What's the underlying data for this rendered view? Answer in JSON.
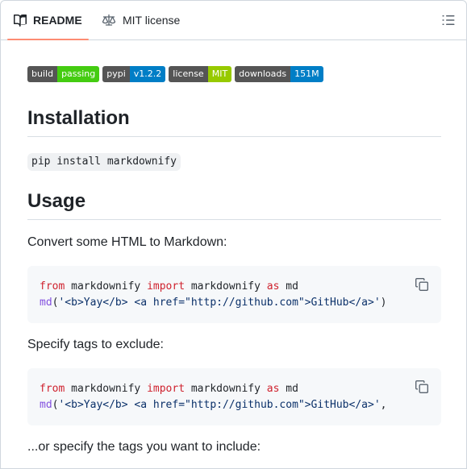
{
  "tabs": {
    "readme_label": "README",
    "license_label": "MIT license"
  },
  "badges": [
    {
      "label": "build",
      "value": "passing",
      "color": "#4c1"
    },
    {
      "label": "pypi",
      "value": "v1.2.2",
      "color": "#007ec6"
    },
    {
      "label": "license",
      "value": "MIT",
      "color": "#97ca00"
    },
    {
      "label": "downloads",
      "value": "151M",
      "color": "#007ec6"
    }
  ],
  "installation": {
    "heading": "Installation",
    "command": "pip install markdownify"
  },
  "usage": {
    "heading": "Usage",
    "intro": "Convert some HTML to Markdown:",
    "code1": {
      "line1": {
        "kw_from": "from",
        "module": " markdownify ",
        "kw_import": "import",
        "name": " markdownify ",
        "kw_as": "as",
        "alias": " md"
      },
      "line2": {
        "fn": "md",
        "open": "(",
        "str": "'<b>Yay</b> <a href=\"http://github.com\">GitHub</a>'",
        "close": ")"
      }
    },
    "exclude_text": "Specify tags to exclude:",
    "code2": {
      "line1": {
        "kw_from": "from",
        "module": " markdownify ",
        "kw_import": "import",
        "name": " markdownify ",
        "kw_as": "as",
        "alias": " md"
      },
      "line2": {
        "fn": "md",
        "open": "(",
        "str": "'<b>Yay</b> <a href=\"http://github.com\">GitHub</a>'",
        "close": ","
      }
    },
    "include_text": "...or specify the tags you want to include:"
  },
  "icons": {
    "readme": "book-icon",
    "license": "law-scale-icon",
    "toc": "list-unordered-icon",
    "copy": "copy-icon"
  }
}
